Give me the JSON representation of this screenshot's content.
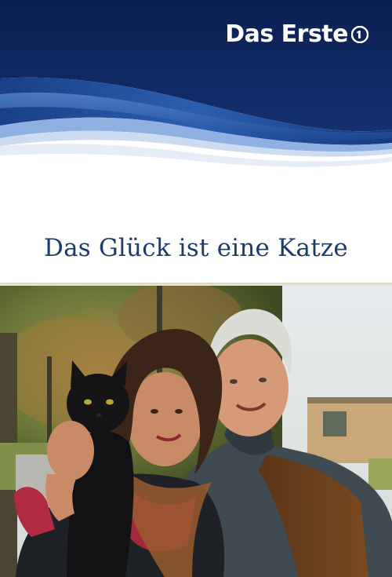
{
  "channel": {
    "name": "Das Erste",
    "logo_icon": "ard-one-logo-icon",
    "brand_color": "#0d2259",
    "wave_color": "#1f4e9a"
  },
  "movie": {
    "title": "Das Glück ist eine Katze",
    "title_color": "#1d3a6e"
  },
  "photo": {
    "subjects": [
      "black cat",
      "woman",
      "man"
    ]
  }
}
